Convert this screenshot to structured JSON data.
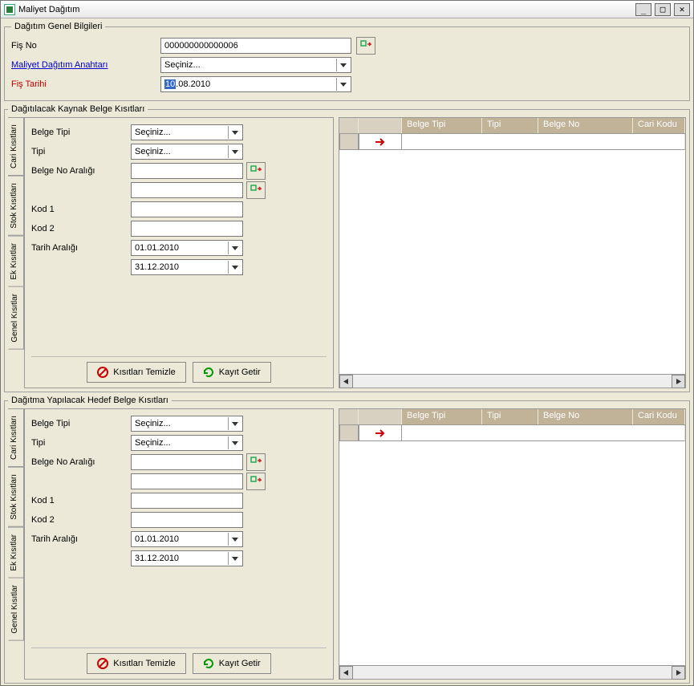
{
  "window": {
    "title": "Maliyet Dağıtım"
  },
  "general": {
    "legend": "Dağıtım Genel Bilgileri",
    "fis_no_label": "Fiş No",
    "fis_no_value": "000000000000006",
    "anahtar_label": "Maliyet Dağıtım Anahtarı",
    "anahtar_value": "Seçiniz...",
    "fis_tarihi_label": "Fiş Tarihi",
    "fis_tarihi_day_sel": "10",
    "fis_tarihi_rest": ".08.2010"
  },
  "source": {
    "legend": "Dağıtılacak Kaynak Belge Kısıtları",
    "tabs": {
      "t1": "Genel Kısıtlar",
      "t2": "Ek Kısıtlar",
      "t3": "Stok Kısıtları",
      "t4": "Cari Kısıtları"
    },
    "belge_tipi_label": "Belge Tipi",
    "belge_tipi_value": "Seçiniz...",
    "tipi_label": "Tipi",
    "tipi_value": "Seçiniz...",
    "belge_no_label": "Belge No Aralığı",
    "belge_no_from": "",
    "belge_no_to": "",
    "kod1_label": "Kod 1",
    "kod1_value": "",
    "kod2_label": "Kod 2",
    "kod2_value": "",
    "tarih_label": "Tarih Aralığı",
    "tarih_from": "01.01.2010",
    "tarih_to": "31.12.2010",
    "btn_clear": "Kısıtları Temizle",
    "btn_fetch": "Kayıt Getir",
    "grid_headers": {
      "c1": "Belge Tipi",
      "c2": "Tipi",
      "c3": "Belge No",
      "c4": "Cari Kodu"
    }
  },
  "target": {
    "legend": "Dağıtma Yapılacak Hedef Belge Kısıtları",
    "tabs": {
      "t1": "Genel Kısıtlar",
      "t2": "Ek Kısıtlar",
      "t3": "Stok Kısıtları",
      "t4": "Cari Kısıtları"
    },
    "belge_tipi_label": "Belge Tipi",
    "belge_tipi_value": "Seçiniz...",
    "tipi_label": "Tipi",
    "tipi_value": "Seçiniz...",
    "belge_no_label": "Belge No Aralığı",
    "belge_no_from": "",
    "belge_no_to": "",
    "kod1_label": "Kod 1",
    "kod1_value": "",
    "kod2_label": "Kod 2",
    "kod2_value": "",
    "tarih_label": "Tarih Aralığı",
    "tarih_from": "01.01.2010",
    "tarih_to": "31.12.2010",
    "btn_clear": "Kısıtları Temizle",
    "btn_fetch": "Kayıt Getir",
    "grid_headers": {
      "c1": "Belge Tipi",
      "c2": "Tipi",
      "c3": "Belge No",
      "c4": "Cari Kodu"
    }
  }
}
